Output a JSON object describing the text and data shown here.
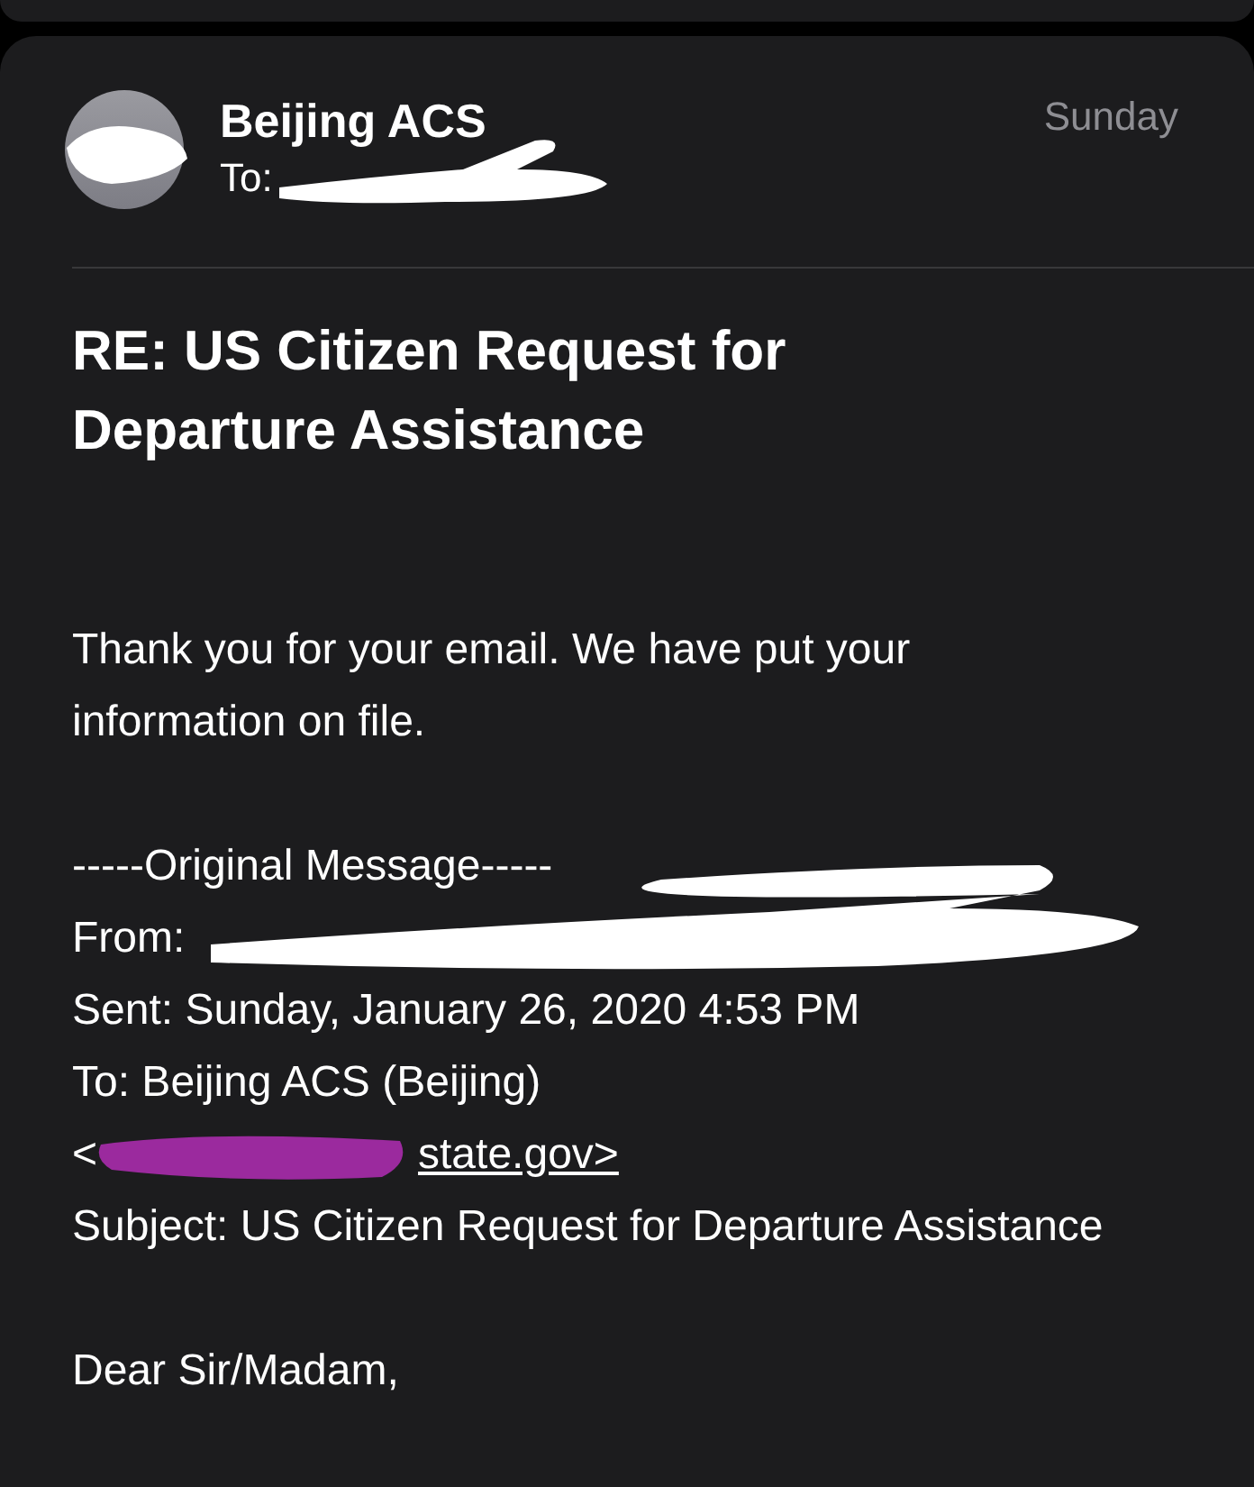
{
  "message": {
    "sender": "Beijing ACS",
    "avatar_redacted": true,
    "to": {
      "label": "To:",
      "redacted": true
    },
    "date": "Sunday",
    "subject": "RE:  US Citizen Request for Departure Assistance",
    "body": [
      "Thank you for your email. We have put your information on file."
    ],
    "original": {
      "separator": "-----Original Message-----",
      "from": {
        "label": "From:",
        "redacted": true
      },
      "sent": "Sent: Sunday, January 26, 2020 4:53 PM",
      "to": "To: Beijing ACS (Beijing)",
      "email": {
        "open": "<",
        "redacted": true,
        "link": "state.gov>"
      },
      "subject": "Subject: US Citizen Request for Departure Assistance"
    },
    "greeting": "Dear Sir/Madam,"
  }
}
